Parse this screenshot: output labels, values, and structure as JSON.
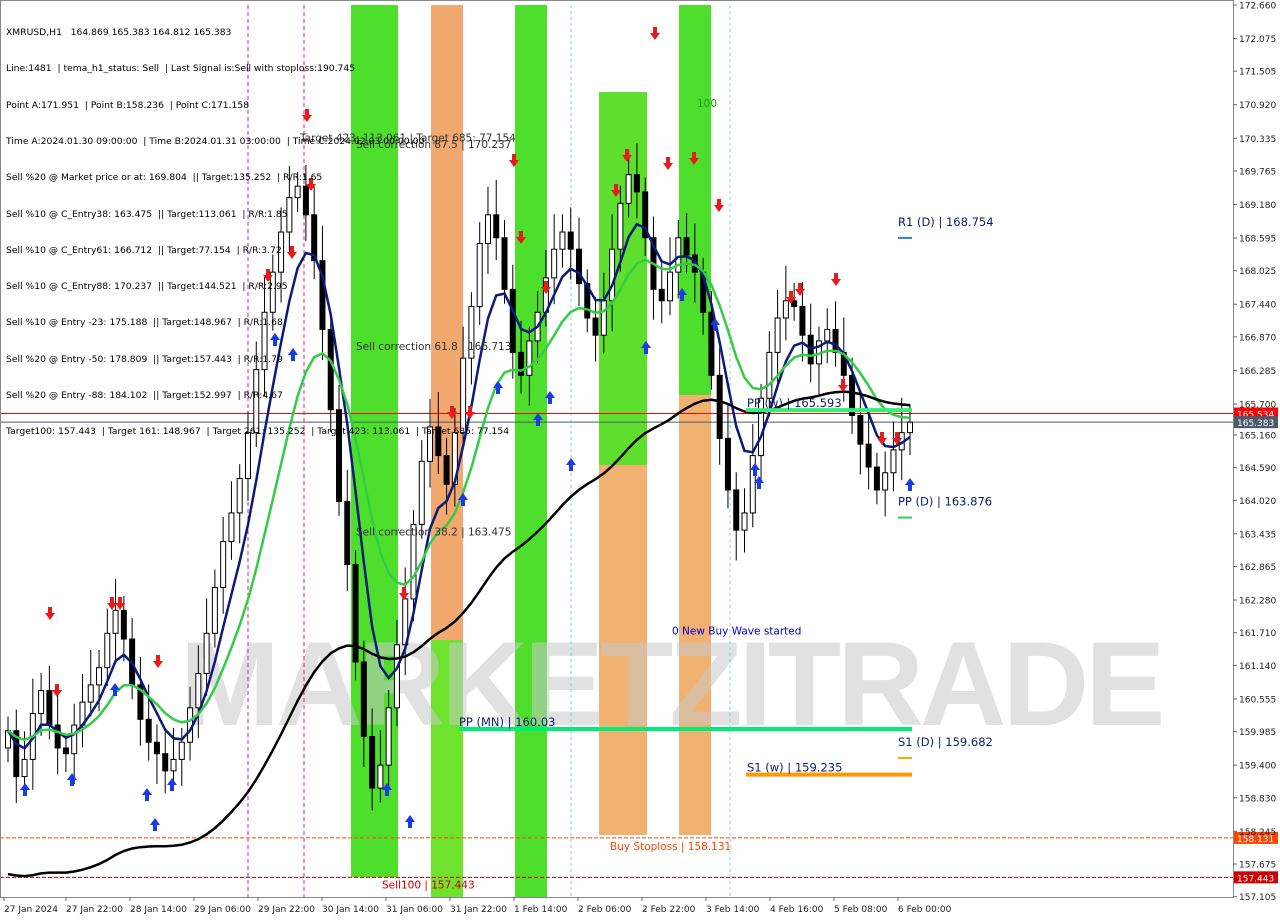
{
  "header": {
    "lines": [
      "XMRUSD,H1   164.869 165.383 164.812 165.383",
      "Line:1481  | tema_h1_status: Sell  | Last Signal is:Sell with stoploss:190.745",
      "Point A:171.951  | Point B:158.236  | Point C:171.158",
      "Time A:2024.01.30 09:00:00  | Time B:2024.01.31 03:00:00  | Time C:2024.02.03 00:00:00",
      "Sell %20 @ Market price or at: 169.804  || Target:135.252  | R/R:1.65",
      "Sell %10 @ C_Entry38: 163.475  || Target:113.061  | R/R:1.85",
      "Sell %10 @ C_Entry61: 166.712  || Target:77.154  | R/R:3.72",
      "Sell %10 @ C_Entry88: 170.237  || Target:144.521  | R/R:2.95",
      "Sell %10 @ Entry -23: 175.188  || Target:148.967  | R/R:1.68",
      "Sell %20 @ Entry -50: 178.809  || Target:157.443  | R/R:1.79",
      "Sell %20 @ Entry -88: 184.102  || Target:152.997  | R/R:4.67",
      "Target100: 157.443  | Target 161: 148.967  | Target 261: 135.252  | Target 423: 113.061  | Target 685: 77.154"
    ]
  },
  "watermark": "MARKETZITRADE",
  "chart_data": {
    "type": "candlestick",
    "symbol": "XMRUSD,H1",
    "ohlc_last": {
      "open": 164.869,
      "high": 165.383,
      "low": 164.812,
      "close": 165.383
    },
    "ylim": [
      157.1,
      172.66
    ],
    "y_ticks": [
      "172.660",
      "172.075",
      "171.505",
      "170.920",
      "170.335",
      "169.765",
      "169.180",
      "168.595",
      "168.025",
      "167.440",
      "166.870",
      "166.285",
      "165.700",
      "165.160",
      "164.590",
      "164.020",
      "163.435",
      "162.865",
      "162.280",
      "161.710",
      "161.140",
      "160.555",
      "159.985",
      "159.400",
      "158.830",
      "158.245",
      "157.675",
      "157.105"
    ],
    "x_ticks": [
      "27 Jan 2024",
      "27 Jan 22:00",
      "28 Jan 14:00",
      "29 Jan 06:00",
      "29 Jan 22:00",
      "30 Jan 14:00",
      "31 Jan 06:00",
      "31 Jan 22:00",
      "1 Feb 14:00",
      "2 Feb 06:00",
      "2 Feb 22:00",
      "3 Feb 14:00",
      "4 Feb 16:00",
      "5 Feb 08:00",
      "6 Feb 00:00"
    ],
    "price_tags": [
      {
        "label": "165.534",
        "value": 165.534,
        "color": "#ff0000"
      },
      {
        "label": "165.383",
        "value": 165.383,
        "color": "#4a5a6a"
      },
      {
        "label": "158.131",
        "value": 158.131,
        "color": "#ff4500"
      },
      {
        "label": "157.443",
        "value": 157.443,
        "color": "#cc0000"
      }
    ],
    "levels": [
      {
        "label": "R1 (D) | 168.754",
        "value": 168.754,
        "color": "#3a7bd5",
        "kind": "tick"
      },
      {
        "label": "PP (w) | 165.593",
        "value": 165.593,
        "color": "#33ee77",
        "kind": "line"
      },
      {
        "label": "PP (D) | 163.876",
        "value": 163.876,
        "color": "#33cc55",
        "kind": "tick"
      },
      {
        "label": "PP (MN) | 160.03",
        "value": 160.03,
        "color": "#00ee77",
        "kind": "line"
      },
      {
        "label": "S1 (D) | 159.682",
        "value": 159.682,
        "color": "#ffa500",
        "kind": "tick"
      },
      {
        "label": "S1 (w) | 159.235",
        "value": 159.235,
        "color": "#ff9900",
        "kind": "line"
      }
    ],
    "annotations": [
      {
        "text": "Sell correction 87.5 | 170.237",
        "value": 170.237,
        "color": "#333333"
      },
      {
        "text": "Sell correction 61.8 | 166.713",
        "value": 166.713,
        "color": "#333333"
      },
      {
        "text": "Sell correction 38.2 | 163.475",
        "value": 163.475,
        "color": "#333333"
      },
      {
        "text": "0 New Buy Wave started",
        "value": 161.75,
        "color": "#0000cc"
      },
      {
        "text": "Buy Stoploss | 158.131",
        "value": 158.131,
        "color": "#ff4500"
      },
      {
        "text": "100",
        "value": 170.95,
        "color": "#1a9e1a"
      },
      {
        "text": "Target 423: 113.061 | Target 685: 77.154",
        "value": 170.35,
        "color": "#333333"
      },
      {
        "text": "Sell100 | 157.443",
        "value": 157.443,
        "color": "#cc0000"
      }
    ],
    "close_series": [
      160.0,
      159.2,
      159.5,
      160.3,
      160.7,
      160.1,
      159.7,
      159.6,
      160.1,
      160.5,
      160.8,
      161.1,
      161.7,
      162.1,
      161.6,
      160.8,
      160.2,
      159.8,
      159.6,
      159.3,
      159.5,
      159.8,
      160.4,
      161.0,
      161.7,
      162.5,
      163.3,
      163.8,
      164.4,
      165.2,
      166.3,
      167.3,
      168.0,
      168.7,
      169.3,
      169.5,
      169.0,
      168.2,
      167.0,
      165.6,
      164.0,
      162.9,
      161.2,
      159.9,
      159.0,
      159.4,
      160.4,
      161.5,
      162.3,
      163.6,
      164.7,
      165.3,
      164.8,
      164.3,
      165.2,
      166.5,
      167.4,
      168.5,
      169.0,
      168.6,
      167.7,
      166.6,
      166.2,
      166.8,
      167.3,
      167.9,
      168.4,
      168.7,
      168.4,
      167.8,
      167.2,
      166.9,
      167.5,
      168.4,
      169.2,
      169.7,
      169.4,
      168.6,
      167.7,
      167.5,
      168.0,
      168.6,
      168.3,
      168.0,
      167.3,
      166.2,
      165.1,
      164.2,
      163.5,
      163.8,
      164.8,
      165.8,
      166.6,
      167.2,
      167.5,
      167.4,
      166.9,
      166.4,
      166.8,
      167.0,
      166.6,
      166.2,
      165.5,
      165.0,
      164.6,
      164.2,
      164.5,
      164.9,
      165.2,
      165.383
    ],
    "series": [
      {
        "name": "",
        "color": "#0c1a7a",
        "type": "ema-fast"
      },
      {
        "name": "",
        "color": "#33cc44",
        "type": "ema-mid"
      },
      {
        "name": "",
        "color": "#000000",
        "type": "ema-slow"
      }
    ]
  }
}
